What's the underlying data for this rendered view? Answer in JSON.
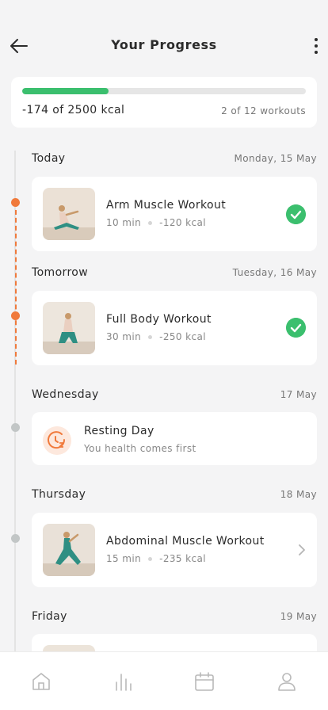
{
  "header": {
    "title": "Your Progress",
    "back_icon": "arrow-left-icon",
    "menu_icon": "more-vertical-icon"
  },
  "summary": {
    "kcal_text": "-174 of 2500 kcal",
    "workouts_text": "2 of 12 workouts",
    "progress": 0.305,
    "accent": "#3bbf6e"
  },
  "days": [
    {
      "name": "Today",
      "date": "Monday, 15 May"
    },
    {
      "name": "Tomorrow",
      "date": "Tuesday, 16 May"
    },
    {
      "name": "Wednesday",
      "date": "17 May"
    },
    {
      "name": "Thursday",
      "date": "18 May"
    },
    {
      "name": "Friday",
      "date": "19 May"
    }
  ],
  "workouts": [
    {
      "title": "Arm Muscle Workout",
      "duration": "10 min",
      "kcal": "-120 kcal",
      "status": "completed"
    },
    {
      "title": "Full Body Workout",
      "duration": "30 min",
      "kcal": "-250 kcal",
      "status": "completed"
    },
    {
      "title": "Abdominal Muscle Workout",
      "duration": "15 min",
      "kcal": "-235 kcal",
      "status": "upcoming"
    }
  ],
  "rest": {
    "title": "Resting Day",
    "subtitle": "You health comes first",
    "icon": "rest-clock-icon"
  },
  "colors": {
    "timeline_active": "#f07a3c",
    "timeline_inactive": "#c2c6c6",
    "check": "#3bbf6e"
  },
  "tabbar": {
    "icons": [
      "home-icon",
      "stats-icon",
      "calendar-icon",
      "profile-icon"
    ]
  }
}
